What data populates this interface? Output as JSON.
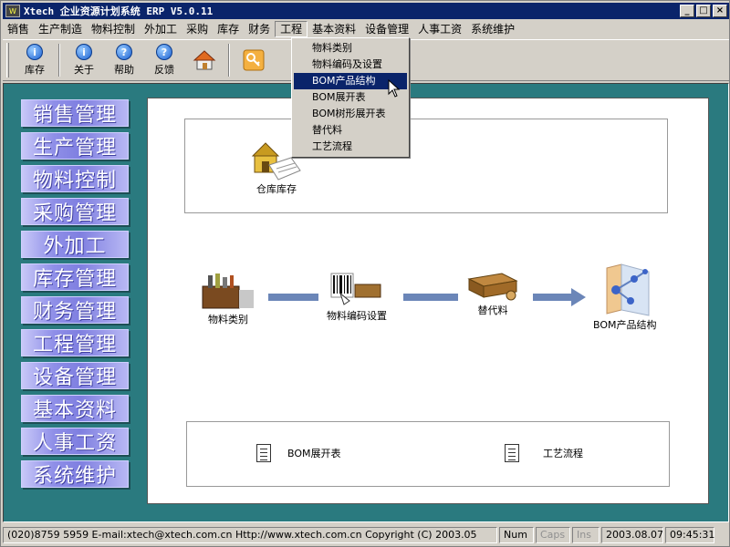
{
  "window": {
    "title": "Xtech 企业资源计划系统 ERP V5.0.11",
    "minimize": "_",
    "maximize": "□",
    "close": "×"
  },
  "menubar": [
    "销售",
    "生产制造",
    "物料控制",
    "外加工",
    "采购",
    "库存",
    "财务",
    "工程",
    "基本资料",
    "设备管理",
    "人事工资",
    "系统维护"
  ],
  "toolbar": {
    "inventory": "库存",
    "about": "关于",
    "help": "帮助",
    "feedback": "反馈"
  },
  "dropdown": {
    "items": [
      "物料类别",
      "物料编码及设置",
      "BOM产品结构",
      "BOM展开表",
      "BOM树形展开表",
      "替代料",
      "工艺流程"
    ],
    "selected_index": 2
  },
  "sidebar": [
    "销售管理",
    "生产管理",
    "物料控制",
    "采购管理",
    "外加工",
    "库存管理",
    "财务管理",
    "工程管理",
    "设备管理",
    "基本资料",
    "人事工资",
    "系统维护"
  ],
  "panel": {
    "warehouse": "仓库库存",
    "material_category": "物料类别",
    "material_code": "物料编码设置",
    "substitute": "替代料",
    "bom_structure": "BOM产品结构",
    "bom_expand": "BOM展开表",
    "process": "工艺流程"
  },
  "statusbar": {
    "info": "(020)8759 5959  E-mail:xtech@xtech.com.cn  Http://www.xtech.com.cn Copyright (C) 2003.05",
    "num": "Num",
    "caps": "Caps",
    "ins": "Ins",
    "date": "2003.08.07",
    "time": "09:45:31"
  }
}
